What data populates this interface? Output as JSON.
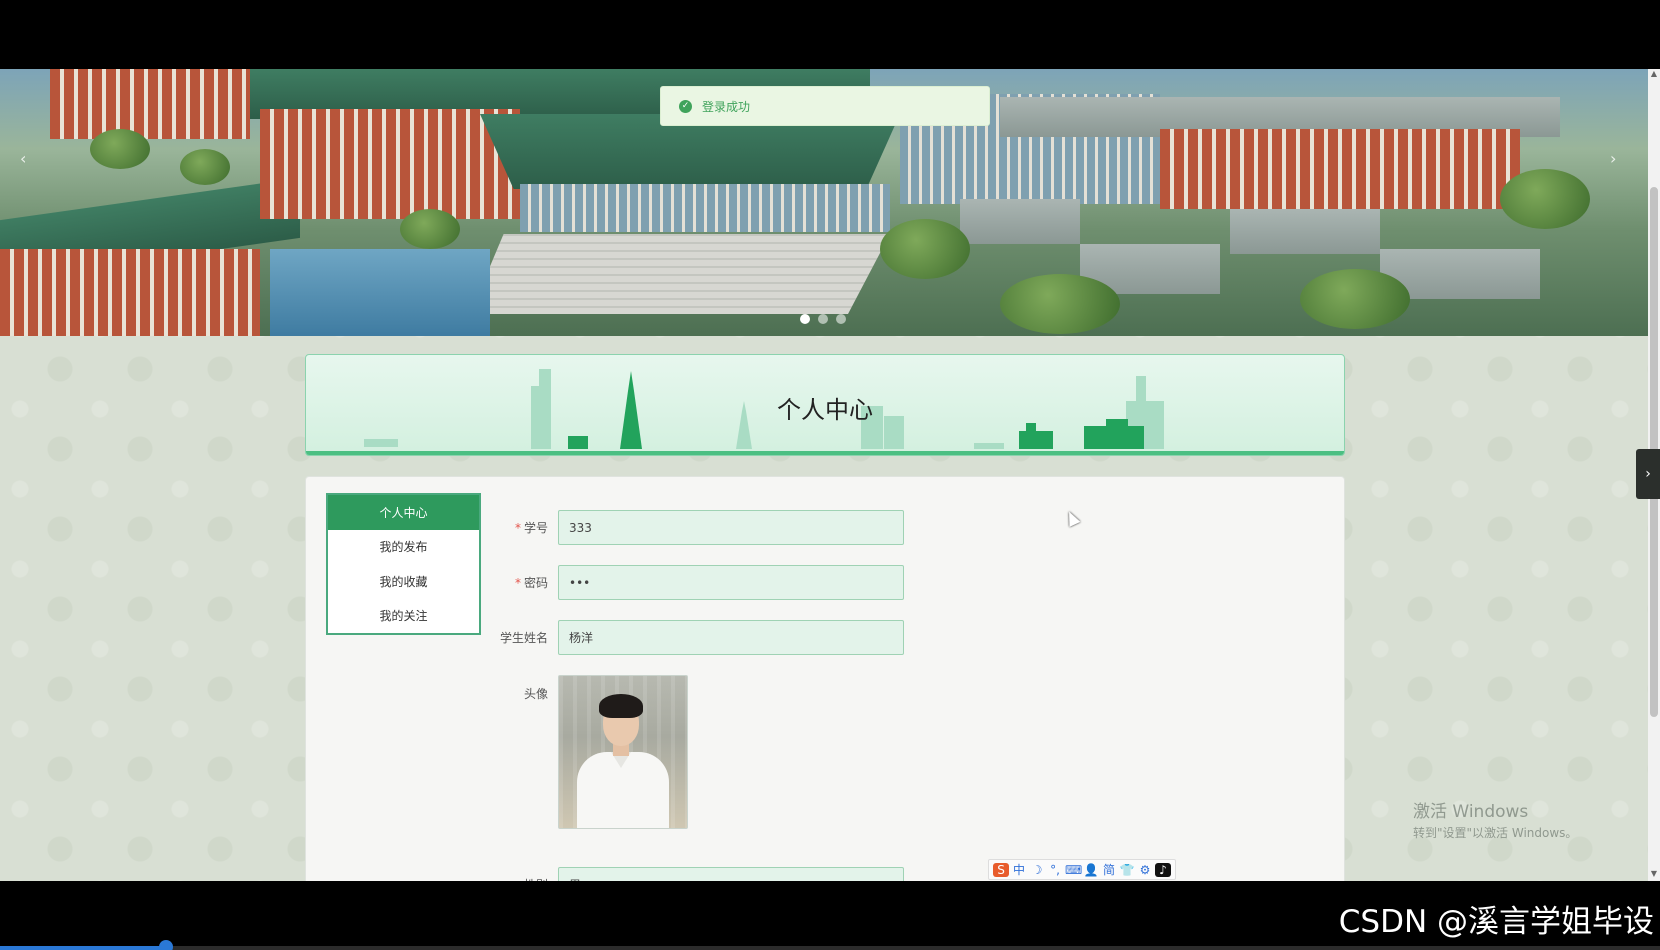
{
  "toast": {
    "message": "登录成功"
  },
  "banner": {
    "slide_count": 3,
    "active_slide": 1
  },
  "page": {
    "title": "个人中心"
  },
  "side_menu": {
    "items": [
      {
        "label": "个人中心",
        "active": true
      },
      {
        "label": "我的发布",
        "active": false
      },
      {
        "label": "我的收藏",
        "active": false
      },
      {
        "label": "我的关注",
        "active": false
      }
    ]
  },
  "form": {
    "student_id": {
      "label": "学号",
      "required": true,
      "value": "333"
    },
    "password": {
      "label": "密码",
      "required": true,
      "value": "•••"
    },
    "student_name": {
      "label": "学生姓名",
      "required": false,
      "value": "杨洋"
    },
    "avatar": {
      "label": "头像"
    },
    "gender": {
      "label": "性别",
      "value": "男"
    }
  },
  "watermark": {
    "line1": "激活 Windows",
    "line2": "转到\"设置\"以激活 Windows。"
  },
  "ime_toolbar": {
    "items": [
      "中",
      "☽",
      "°,",
      "⌨",
      "👤",
      "简",
      "👕",
      "⚙"
    ]
  },
  "video_overlay": {
    "text": "CSDN @溪言学姐毕设",
    "progress": 0.1
  },
  "colors": {
    "primary": "#2e9a5d",
    "toast_text": "#3fa35b",
    "input_bg": "#e3f3ea"
  }
}
